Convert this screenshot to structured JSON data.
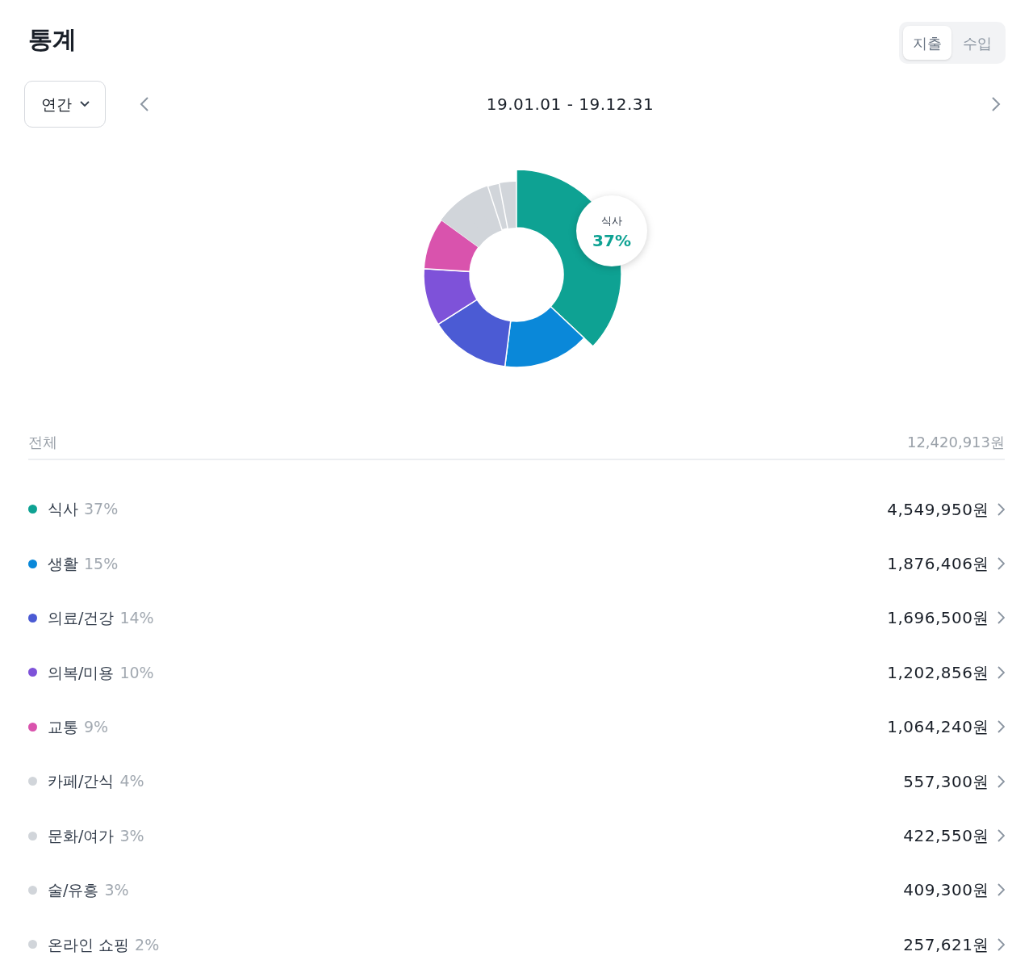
{
  "title": "통계",
  "type_toggle": [
    {
      "label": "지출",
      "selected": true
    },
    {
      "label": "수입",
      "selected": false
    }
  ],
  "period_dropdown": {
    "value": "연간"
  },
  "date_range": "19.01.01 - 19.12.31",
  "donut_tooltip": {
    "label": "식사",
    "percent": "37%"
  },
  "total": {
    "label": "전체",
    "amount": "12,420,913원"
  },
  "categories": [
    {
      "name": "식사",
      "percent": "37%",
      "amount": "4,549,950원",
      "color": "#0ea293",
      "selected": true
    },
    {
      "name": "생활",
      "percent": "15%",
      "amount": "1,876,406원",
      "color": "#0a88d9",
      "selected": false
    },
    {
      "name": "의료/건강",
      "percent": "14%",
      "amount": "1,696,500원",
      "color": "#4b5bd4",
      "selected": false
    },
    {
      "name": "의복/미용",
      "percent": "10%",
      "amount": "1,202,856원",
      "color": "#7e52d9",
      "selected": false
    },
    {
      "name": "교통",
      "percent": "9%",
      "amount": "1,064,240원",
      "color": "#d953ad",
      "selected": false
    },
    {
      "name": "카페/간식",
      "percent": "4%",
      "amount": "557,300원",
      "color": "#d1d5da",
      "selected": false
    },
    {
      "name": "문화/여가",
      "percent": "3%",
      "amount": "422,550원",
      "color": "#d1d5da",
      "selected": false
    },
    {
      "name": "술/유흥",
      "percent": "3%",
      "amount": "409,300원",
      "color": "#d1d5da",
      "selected": false
    },
    {
      "name": "온라인 쇼핑",
      "percent": "2%",
      "amount": "257,621원",
      "color": "#d1d5da",
      "selected": false
    }
  ]
}
